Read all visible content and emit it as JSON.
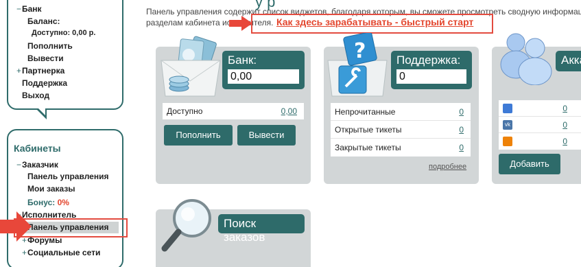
{
  "sidebar_top": {
    "bank_label": "Банк",
    "balance_label": "Баланс:",
    "available_text": "Доступно: 0,00 р.",
    "topup_label": "Пополнить",
    "withdraw_label": "Вывести",
    "partner_label": "Партнерка",
    "support_label": "Поддержка",
    "logout_label": "Выход"
  },
  "sidebar_cabinets": {
    "title": "Кабинеты",
    "customer_label": "Заказчик",
    "customer_items": [
      "Панель управления",
      "Мои заказы"
    ],
    "bonus_label": "Бонус:",
    "bonus_value": "0%",
    "executor_label": "Исполнитель",
    "executor_active_item": "Панель управления",
    "forums_label": "Форумы",
    "social_label": "Социальные сети"
  },
  "main": {
    "heading_fragment": "у р",
    "intro_line1": "Панель управления содержит список виджетов, благодаря которым, вы сможете просмотреть сводную информац",
    "intro_line2": "разделам кабинета исполнителя.",
    "quick_start_link": "Как здесь зарабатывать - быстрый старт"
  },
  "widgets": {
    "bank": {
      "title": "Банк:",
      "value": "0,00",
      "row_label": "Доступно",
      "row_value": "0,00",
      "topup_button": "Пополнить",
      "withdraw_button": "Вывести"
    },
    "support": {
      "title": "Поддержка:",
      "value": "0",
      "rows": [
        {
          "label": "Непрочитанные",
          "value": "0"
        },
        {
          "label": "Открытые тикеты",
          "value": "0"
        },
        {
          "label": "Закрытые тикеты",
          "value": "0"
        }
      ],
      "more_link": "подробнее"
    },
    "accounts": {
      "title": "Акка",
      "rows": [
        {
          "network": "mail-ru",
          "value": "0"
        },
        {
          "network": "vk",
          "value": "0"
        },
        {
          "network": "odnoklassniki",
          "value": "0"
        }
      ],
      "add_button": "Добавить"
    },
    "orders": {
      "title": "Поиск заказов"
    }
  },
  "colors": {
    "accent": "#2e6b6a",
    "highlight_red": "#e34b3f",
    "widget_bg": "#d2d6d7"
  }
}
